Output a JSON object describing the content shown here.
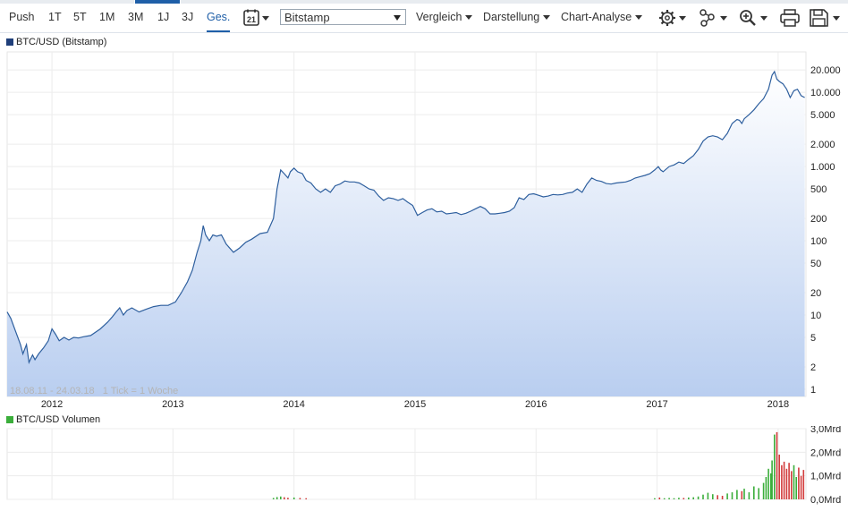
{
  "periods": [
    "Push",
    "1T",
    "5T",
    "1M",
    "3M",
    "1J",
    "3J",
    "Ges."
  ],
  "active_period": "Ges.",
  "calendar_icon_label": "21",
  "exchange_select": {
    "value": "Bitstamp"
  },
  "menus": {
    "compare": "Vergleich",
    "display": "Darstellung",
    "analysis": "Chart-Analyse"
  },
  "toolbar_icons": [
    "settings-icon",
    "share-icon",
    "zoom-icon",
    "print-icon",
    "save-icon"
  ],
  "price_legend": "BTC/USD (Bitstamp)",
  "volume_legend": "BTC/USD Volumen",
  "info_text": "18.08.11 - 24.03.18   1 Tick = 1 Woche",
  "colors": {
    "accent": "#1f5fa8",
    "line": "#2e5f9e",
    "volume_up": "#3bae3b",
    "volume_down": "#d23c3c"
  },
  "chart_data": [
    {
      "type": "area",
      "title": "BTC/USD (Bitstamp)",
      "yscale": "log",
      "ylim": [
        0.8,
        35000
      ],
      "yticks": [
        1,
        2,
        5,
        10,
        20,
        50,
        100,
        200,
        500,
        1000,
        2000,
        5000,
        10000,
        20000
      ],
      "ytick_labels": [
        "1",
        "2",
        "5",
        "10",
        "20",
        "50",
        "100",
        "200",
        "500",
        "1.000",
        "2.000",
        "5.000",
        "10.000",
        "20.000"
      ],
      "xlim": [
        2011.63,
        2018.23
      ],
      "xticks": [
        2012,
        2013,
        2014,
        2015,
        2016,
        2017,
        2018
      ],
      "grid": true,
      "series": [
        {
          "name": "BTC/USD (Bitstamp)",
          "points": [
            [
              2011.63,
              11
            ],
            [
              2011.66,
              9
            ],
            [
              2011.7,
              6
            ],
            [
              2011.74,
              4
            ],
            [
              2011.76,
              3
            ],
            [
              2011.79,
              4
            ],
            [
              2011.81,
              2.3
            ],
            [
              2011.84,
              2.9
            ],
            [
              2011.86,
              2.5
            ],
            [
              2011.89,
              3
            ],
            [
              2011.93,
              3.6
            ],
            [
              2011.97,
              4.5
            ],
            [
              2012.0,
              6.5
            ],
            [
              2012.03,
              5.5
            ],
            [
              2012.06,
              4.5
            ],
            [
              2012.1,
              5
            ],
            [
              2012.14,
              4.6
            ],
            [
              2012.18,
              5
            ],
            [
              2012.22,
              4.9
            ],
            [
              2012.26,
              5.1
            ],
            [
              2012.32,
              5.3
            ],
            [
              2012.4,
              6.5
            ],
            [
              2012.46,
              8
            ],
            [
              2012.5,
              9.5
            ],
            [
              2012.53,
              11
            ],
            [
              2012.56,
              12.5
            ],
            [
              2012.59,
              10
            ],
            [
              2012.62,
              11.5
            ],
            [
              2012.66,
              12.5
            ],
            [
              2012.72,
              11
            ],
            [
              2012.78,
              12
            ],
            [
              2012.84,
              13
            ],
            [
              2012.9,
              13.5
            ],
            [
              2012.96,
              13.5
            ],
            [
              2013.02,
              15
            ],
            [
              2013.07,
              20
            ],
            [
              2013.12,
              28
            ],
            [
              2013.16,
              40
            ],
            [
              2013.2,
              70
            ],
            [
              2013.23,
              100
            ],
            [
              2013.25,
              160
            ],
            [
              2013.27,
              120
            ],
            [
              2013.3,
              100
            ],
            [
              2013.33,
              120
            ],
            [
              2013.36,
              115
            ],
            [
              2013.4,
              120
            ],
            [
              2013.44,
              90
            ],
            [
              2013.5,
              70
            ],
            [
              2013.55,
              80
            ],
            [
              2013.6,
              95
            ],
            [
              2013.65,
              105
            ],
            [
              2013.72,
              125
            ],
            [
              2013.78,
              130
            ],
            [
              2013.83,
              200
            ],
            [
              2013.86,
              500
            ],
            [
              2013.89,
              900
            ],
            [
              2013.92,
              800
            ],
            [
              2013.95,
              700
            ],
            [
              2013.97,
              850
            ],
            [
              2014.0,
              950
            ],
            [
              2014.03,
              850
            ],
            [
              2014.07,
              800
            ],
            [
              2014.1,
              650
            ],
            [
              2014.14,
              600
            ],
            [
              2014.18,
              500
            ],
            [
              2014.22,
              450
            ],
            [
              2014.26,
              500
            ],
            [
              2014.3,
              450
            ],
            [
              2014.34,
              550
            ],
            [
              2014.38,
              580
            ],
            [
              2014.42,
              640
            ],
            [
              2014.46,
              620
            ],
            [
              2014.5,
              620
            ],
            [
              2014.54,
              600
            ],
            [
              2014.58,
              550
            ],
            [
              2014.62,
              500
            ],
            [
              2014.66,
              480
            ],
            [
              2014.7,
              400
            ],
            [
              2014.74,
              350
            ],
            [
              2014.78,
              380
            ],
            [
              2014.82,
              370
            ],
            [
              2014.86,
              350
            ],
            [
              2014.9,
              370
            ],
            [
              2014.94,
              330
            ],
            [
              2014.98,
              300
            ],
            [
              2015.02,
              220
            ],
            [
              2015.06,
              240
            ],
            [
              2015.1,
              260
            ],
            [
              2015.14,
              270
            ],
            [
              2015.18,
              245
            ],
            [
              2015.22,
              250
            ],
            [
              2015.26,
              230
            ],
            [
              2015.3,
              235
            ],
            [
              2015.34,
              240
            ],
            [
              2015.38,
              225
            ],
            [
              2015.42,
              235
            ],
            [
              2015.46,
              250
            ],
            [
              2015.5,
              270
            ],
            [
              2015.54,
              290
            ],
            [
              2015.58,
              270
            ],
            [
              2015.62,
              230
            ],
            [
              2015.66,
              230
            ],
            [
              2015.7,
              235
            ],
            [
              2015.74,
              240
            ],
            [
              2015.78,
              250
            ],
            [
              2015.82,
              280
            ],
            [
              2015.86,
              380
            ],
            [
              2015.9,
              360
            ],
            [
              2015.94,
              420
            ],
            [
              2015.98,
              430
            ],
            [
              2016.02,
              410
            ],
            [
              2016.06,
              390
            ],
            [
              2016.1,
              400
            ],
            [
              2016.14,
              420
            ],
            [
              2016.18,
              415
            ],
            [
              2016.22,
              420
            ],
            [
              2016.26,
              440
            ],
            [
              2016.3,
              450
            ],
            [
              2016.34,
              500
            ],
            [
              2016.38,
              450
            ],
            [
              2016.42,
              580
            ],
            [
              2016.46,
              700
            ],
            [
              2016.5,
              650
            ],
            [
              2016.54,
              630
            ],
            [
              2016.58,
              590
            ],
            [
              2016.62,
              580
            ],
            [
              2016.66,
              600
            ],
            [
              2016.7,
              610
            ],
            [
              2016.74,
              620
            ],
            [
              2016.78,
              650
            ],
            [
              2016.82,
              700
            ],
            [
              2016.86,
              730
            ],
            [
              2016.9,
              760
            ],
            [
              2016.94,
              800
            ],
            [
              2016.98,
              900
            ],
            [
              2017.01,
              1000
            ],
            [
              2017.03,
              900
            ],
            [
              2017.05,
              850
            ],
            [
              2017.1,
              1000
            ],
            [
              2017.14,
              1050
            ],
            [
              2017.18,
              1150
            ],
            [
              2017.22,
              1100
            ],
            [
              2017.26,
              1250
            ],
            [
              2017.3,
              1400
            ],
            [
              2017.34,
              1700
            ],
            [
              2017.38,
              2200
            ],
            [
              2017.42,
              2500
            ],
            [
              2017.46,
              2600
            ],
            [
              2017.5,
              2500
            ],
            [
              2017.54,
              2300
            ],
            [
              2017.58,
              2800
            ],
            [
              2017.62,
              3800
            ],
            [
              2017.66,
              4300
            ],
            [
              2017.68,
              4200
            ],
            [
              2017.7,
              3800
            ],
            [
              2017.72,
              4400
            ],
            [
              2017.76,
              5000
            ],
            [
              2017.8,
              5800
            ],
            [
              2017.84,
              7000
            ],
            [
              2017.88,
              8200
            ],
            [
              2017.92,
              11000
            ],
            [
              2017.95,
              17000
            ],
            [
              2017.97,
              19000
            ],
            [
              2017.99,
              15000
            ],
            [
              2018.01,
              14000
            ],
            [
              2018.04,
              13000
            ],
            [
              2018.07,
              11000
            ],
            [
              2018.1,
              8500
            ],
            [
              2018.13,
              10500
            ],
            [
              2018.16,
              11000
            ],
            [
              2018.19,
              9000
            ],
            [
              2018.22,
              8500
            ]
          ]
        }
      ]
    },
    {
      "type": "bar",
      "title": "BTC/USD Volumen",
      "ylim": [
        0,
        3.0
      ],
      "yticks": [
        0,
        1,
        2,
        3
      ],
      "ytick_labels": [
        "0,0Mrd",
        "1,0Mrd",
        "2,0Mrd",
        "3,0Mrd"
      ],
      "grid": true,
      "series": [
        {
          "name": "BTC/USD Volumen",
          "points": [
            [
              2013.83,
              0.06
            ],
            [
              2013.86,
              0.1
            ],
            [
              2013.89,
              0.12
            ],
            [
              2013.92,
              0.09
            ],
            [
              2013.95,
              0.07
            ],
            [
              2014.0,
              0.08
            ],
            [
              2014.05,
              0.06
            ],
            [
              2014.1,
              0.05
            ],
            [
              2016.98,
              0.05
            ],
            [
              2017.02,
              0.08
            ],
            [
              2017.06,
              0.05
            ],
            [
              2017.1,
              0.06
            ],
            [
              2017.14,
              0.05
            ],
            [
              2017.18,
              0.07
            ],
            [
              2017.22,
              0.06
            ],
            [
              2017.26,
              0.08
            ],
            [
              2017.3,
              0.09
            ],
            [
              2017.34,
              0.12
            ],
            [
              2017.38,
              0.2
            ],
            [
              2017.42,
              0.28
            ],
            [
              2017.46,
              0.22
            ],
            [
              2017.5,
              0.18
            ],
            [
              2017.54,
              0.15
            ],
            [
              2017.58,
              0.25
            ],
            [
              2017.62,
              0.3
            ],
            [
              2017.66,
              0.4
            ],
            [
              2017.7,
              0.35
            ],
            [
              2017.72,
              0.45
            ],
            [
              2017.76,
              0.3
            ],
            [
              2017.8,
              0.55
            ],
            [
              2017.84,
              0.48
            ],
            [
              2017.88,
              0.7
            ],
            [
              2017.9,
              0.95
            ],
            [
              2017.92,
              1.3
            ],
            [
              2017.94,
              1.1
            ],
            [
              2017.95,
              1.65
            ],
            [
              2017.97,
              2.75
            ],
            [
              2017.99,
              2.85
            ],
            [
              2018.01,
              1.9
            ],
            [
              2018.03,
              1.45
            ],
            [
              2018.05,
              1.6
            ],
            [
              2018.07,
              1.3
            ],
            [
              2018.09,
              1.55
            ],
            [
              2018.11,
              1.2
            ],
            [
              2018.13,
              1.45
            ],
            [
              2018.15,
              0.95
            ],
            [
              2018.17,
              1.35
            ],
            [
              2018.19,
              1.0
            ],
            [
              2018.21,
              1.25
            ]
          ]
        }
      ]
    }
  ]
}
